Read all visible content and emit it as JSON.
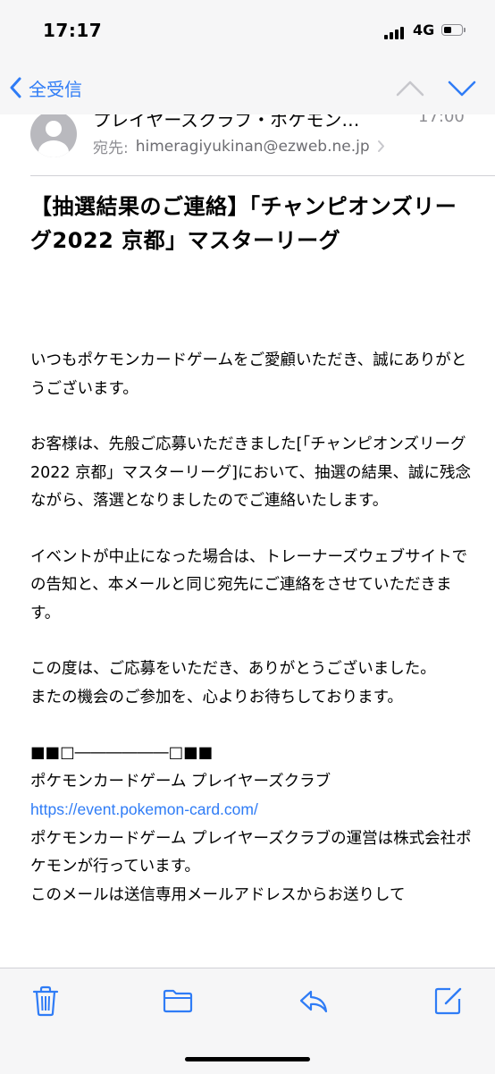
{
  "status_bar": {
    "time": "17:17",
    "network": "4G"
  },
  "nav": {
    "back_label": "全受信"
  },
  "header": {
    "sender": "プレイヤーズクラブ・ポケモン…",
    "time": "17:00",
    "recipient_label": "宛先:",
    "recipient_address": "himeragiyukinan@ezweb.ne.jp"
  },
  "subject": "【抽選結果のご連絡】「チャンピオンズリーグ2022 京都」マスターリーグ",
  "body": {
    "greeting": "いつもポケモンカードゲームをご愛顧いただき、誠にありがとうございます。",
    "result": "お客様は、先般ご応募いただきました[「チャンピオンズリーグ2022 京都」マスターリーグ]において、抽選の結果、誠に残念ながら、落選となりましたのでご連絡いたします。",
    "cancel_notice": "イベントが中止になった場合は、トレーナーズウェブサイトでの告知と、本メールと同じ宛先にご連絡をさせていただきます。",
    "thanks": "この度は、ご応募をいただき、ありがとうございました。",
    "closing": "またの機会のご参加を、心よりお待ちしております。",
    "separator": "■■□――――――□■■",
    "org_name": "ポケモンカードゲーム プレイヤーズクラブ",
    "link": "https://event.pokemon-card.com/",
    "operator": "ポケモンカードゲーム プレイヤーズクラブの運営は株式会社ポケモンが行っています。",
    "noreply": "このメールは送信専用メールアドレスからお送りして"
  },
  "colors": {
    "accent": "#2f7cf6",
    "bar_background": "#f6f6f7",
    "secondary_text": "#8e8e93"
  },
  "icons": {
    "back": "chevron-left-icon",
    "up": "chevron-up-icon",
    "down": "chevron-down-icon",
    "trash": "trash-icon",
    "folder": "folder-icon",
    "reply": "reply-icon",
    "compose": "compose-icon"
  }
}
